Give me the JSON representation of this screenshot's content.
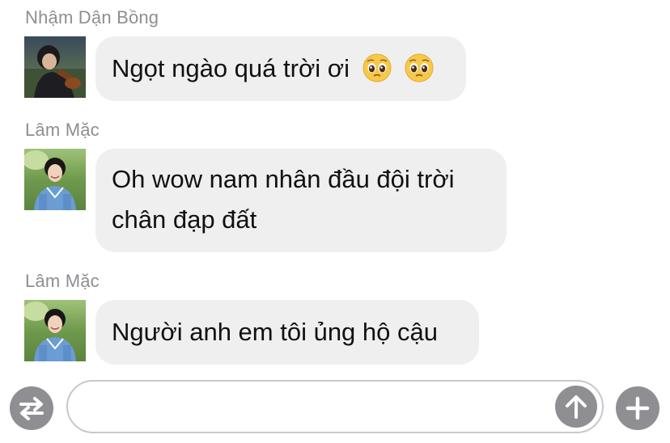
{
  "messages": [
    {
      "sender": "Nhậm Dận Bồng",
      "avatar_icon": "avatar-photo-violin",
      "text": "Ngọt ngào quá trời ơi",
      "emojis": [
        "pleading-face-emoji",
        "pleading-face-emoji"
      ]
    },
    {
      "sender": "Lâm Mặc",
      "avatar_icon": "avatar-photo-outdoor",
      "text_line1": "Oh wow nam nhân đầu đội trời",
      "text_line2": "chân đạp đất"
    },
    {
      "sender": "Lâm Mặc",
      "avatar_icon": "avatar-photo-outdoor",
      "text": "Người anh em tôi ủng hộ cậu"
    }
  ],
  "composer": {
    "value": "",
    "placeholder": "",
    "switch_icon": "swap-arrows-icon",
    "send_icon": "arrow-up-icon",
    "add_icon": "plus-icon"
  },
  "colors": {
    "bubble": "#efeff0",
    "text": "#111111",
    "sender": "#8e8e93",
    "button": "#8e8e93"
  }
}
